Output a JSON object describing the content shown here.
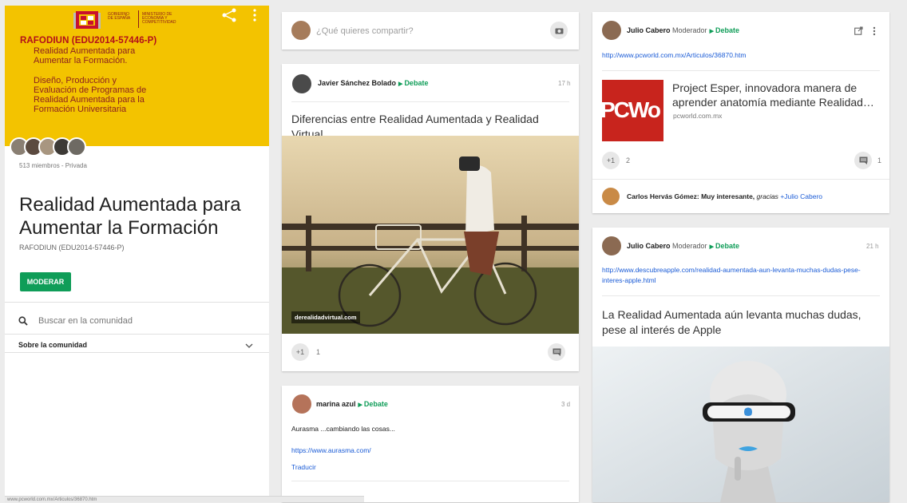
{
  "community": {
    "banner": {
      "gov_left": "GOBIERNO DE ESPAÑA",
      "gov_right": "MINISTERIO DE ECONOMÍA Y COMPETITIVIDAD",
      "title": "RAFODIUN (EDU2014-57446-P)",
      "line1": "Realidad Aumentada para",
      "line2": "Aumentar la Formación.",
      "line3": "Diseño, Producción y",
      "line4": "Evaluación de Programas de",
      "line5": "Realidad Aumentada para la",
      "line6": "Formación Universitaria"
    },
    "members": "513 miembros - Privada",
    "title": "Realidad Aumentada para Aumentar la Formación",
    "subtitle": "RAFODIUN (EDU2014-57446-P)",
    "moderate_label": "MODERAR",
    "search_placeholder": "Buscar en la comunidad",
    "about_label": "Sobre la comunidad"
  },
  "composer": {
    "placeholder": "¿Qué quieres compartir?"
  },
  "posts": [
    {
      "author": "Javier Sánchez Bolado",
      "category": "Debate",
      "time": "17 h",
      "text": "Diferencias entre Realidad Aumentada y Realidad Virtual",
      "image_caption": "derealidadvirtual.com",
      "plus_label": "+1",
      "plus_count": "1"
    },
    {
      "author": "marina azul",
      "category": "Debate",
      "time": "3 d",
      "text": "Aurasma ...cambiando las cosas...",
      "link": "https://www.aurasma.com/",
      "translate": "Traducir"
    },
    {
      "author": "Julio Cabero",
      "role": "Moderador",
      "category": "Debate",
      "link": "http://www.pcworld.com.mx/Articulos/36870.htm",
      "preview_title": "Project Esper, innovadora manera de aprender anatomía mediante Realidad…",
      "preview_domain": "pcworld.com.mx",
      "preview_logo": "PCWo",
      "plus_label": "+1",
      "plus_count": "2",
      "comment_count": "1",
      "comment_author": "Carlos Hervás Gómez:",
      "comment_text": "Muy interesante,",
      "comment_italic": "gracias",
      "comment_mention": "+Julio Cabero"
    },
    {
      "author": "Julio Cabero",
      "role": "Moderador",
      "category": "Debate",
      "time": "21 h",
      "link": "http://www.descubreapple.com/realidad-aumentada-aun-levanta-muchas-dudas-pese-interes-apple.html",
      "text": "La Realidad Aumentada aún levanta muchas dudas, pese al interés de Apple"
    }
  ],
  "status_bar": "www.pcworld.com.mx/Articulos/36870.htm",
  "colors": {
    "banner": "#f3c300",
    "accent": "#0f9d58",
    "link": "#1a5bd6"
  }
}
